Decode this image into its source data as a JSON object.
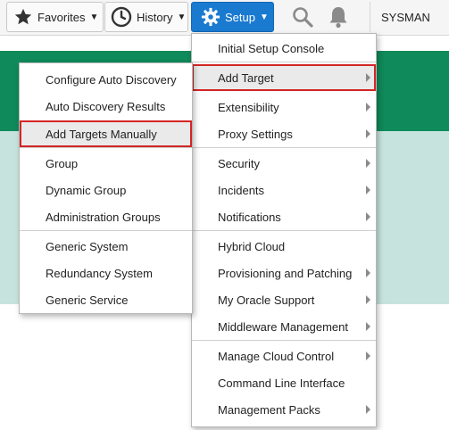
{
  "toolbar": {
    "favorites_label": "Favorites",
    "history_label": "History",
    "setup_label": "Setup",
    "user_label": "SYSMAN",
    "accent_color": "#1a7ad0",
    "icons": [
      "star-icon",
      "clock-icon",
      "gear-icon",
      "search-icon",
      "bell-icon"
    ]
  },
  "page": {
    "header_color": "#0f8a5a",
    "panel_color": "#c6e4dd"
  },
  "setup_menu": {
    "items": [
      {
        "label": "Initial Setup Console",
        "submenu": false
      },
      {
        "label": "Add Target",
        "submenu": true,
        "highlighted": true
      },
      {
        "label": "Extensibility",
        "submenu": true
      },
      {
        "label": "Proxy Settings",
        "submenu": true
      },
      {
        "label": "Security",
        "submenu": true
      },
      {
        "label": "Incidents",
        "submenu": true
      },
      {
        "label": "Notifications",
        "submenu": true
      },
      {
        "label": "Hybrid Cloud",
        "submenu": false
      },
      {
        "label": "Provisioning and Patching",
        "submenu": true
      },
      {
        "label": "My Oracle Support",
        "submenu": true
      },
      {
        "label": "Middleware Management",
        "submenu": true
      },
      {
        "label": "Manage Cloud Control",
        "submenu": true
      },
      {
        "label": "Command Line Interface",
        "submenu": false
      },
      {
        "label": "Management Packs",
        "submenu": true
      }
    ]
  },
  "add_target_menu": {
    "items": [
      {
        "label": "Configure Auto Discovery"
      },
      {
        "label": "Auto Discovery Results"
      },
      {
        "label": "Add Targets Manually",
        "highlighted": true
      },
      {
        "label": "Group"
      },
      {
        "label": "Dynamic Group"
      },
      {
        "label": "Administration Groups"
      },
      {
        "label": "Generic System"
      },
      {
        "label": "Redundancy System"
      },
      {
        "label": "Generic Service"
      }
    ]
  }
}
